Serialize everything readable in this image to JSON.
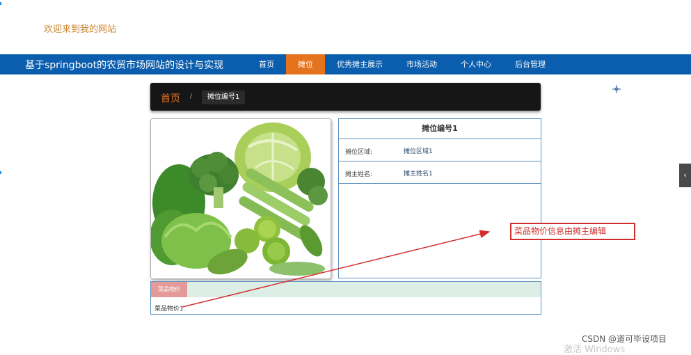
{
  "header": {
    "welcome": "欢迎来到我的网站"
  },
  "navbar": {
    "site_title": "基于springboot的农贸市场网站的设计与实现",
    "items": [
      {
        "label": "首页"
      },
      {
        "label": "摊位",
        "active": true
      },
      {
        "label": "优秀摊主展示"
      },
      {
        "label": "市场活动"
      },
      {
        "label": "个人中心"
      },
      {
        "label": "后台管理"
      }
    ],
    "colors": {
      "bar": "#0b5ead",
      "active": "#e5731d"
    }
  },
  "breadcrumb": {
    "home": "首页",
    "separator": "/",
    "current": "摊位编号1"
  },
  "product_image": {
    "subject": "green vegetables (broccoli, cabbage, lettuce, celery, limes, cucumber)"
  },
  "info_panel": {
    "title": "摊位编号1",
    "rows": [
      {
        "label": "摊位区域:",
        "value": "摊位区域1"
      },
      {
        "label": "摊主姓名:",
        "value": "摊主姓名1"
      }
    ]
  },
  "price_panel": {
    "tab_label": "菜品物价",
    "content": "菜品物价1"
  },
  "annotation": {
    "callout_text": "菜品物价信息由摊主编辑",
    "color": "#d22c2c"
  },
  "side_toggle": {
    "icon": "chevron-left-icon",
    "glyph": "‹"
  },
  "watermarks": {
    "csdn": "CSDN @道可毕设项目",
    "windows": "激活 Windows"
  }
}
